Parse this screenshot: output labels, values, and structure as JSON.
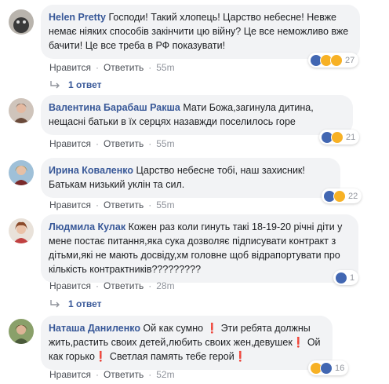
{
  "comments": [
    {
      "author": "Helen Pretty",
      "text": "Господи! Такий хлопець! Царство небесне! Невже немає ніяких способів закінчити цю війну? Це все неможливо вже бачити! Це все треба в РФ показувати!",
      "reactions": [
        "like",
        "sad",
        "wow"
      ],
      "reaction_count": "27",
      "like_label": "Нравится",
      "reply_label": "Ответить",
      "time": "55m",
      "replies_label": "1 ответ"
    },
    {
      "author": "Валентина Барабаш Ракша",
      "text": "Мати Божа,загинула дитина, нещасні батьки в їх серцях назавжди поселилось горе",
      "reactions": [
        "like",
        "sad"
      ],
      "reaction_count": "21",
      "like_label": "Нравится",
      "reply_label": "Ответить",
      "time": "55m"
    },
    {
      "author": "Ирина Коваленко",
      "text": "Царство небесне тобі, наш захисник! Батькам низький уклін та сил.",
      "reactions": [
        "like",
        "sad"
      ],
      "reaction_count": "22",
      "like_label": "Нравится",
      "reply_label": "Ответить",
      "time": "55m"
    },
    {
      "author": "Людмила Кулак",
      "text": "Кожен раз коли гинуть такі 18-19-20 річні діти у мене постає питання,яка сука дозволяє підписувати контракт з дітьми,які не мають досвіду,хм головне щоб відрапортувати про кількість контрактників?????????",
      "reactions": [
        "like"
      ],
      "reaction_count": "1",
      "like_label": "Нравится",
      "reply_label": "Ответить",
      "time": "28m",
      "replies_label": "1 ответ"
    },
    {
      "author": "Наташа Даниленко",
      "text": "Ой как сумно ❗ Эти ребята должны жить,растить своих детей,любить своих жен,девушек❗ Ой как горько❗ Светлая память тебе герой❗",
      "reactions": [
        "sad",
        "like"
      ],
      "reaction_count": "16",
      "like_label": "Нравится",
      "reply_label": "Ответить",
      "time": "52m"
    }
  ],
  "colors": {
    "author": "#385898",
    "bubble": "#f2f3f5",
    "meta": "#90949c",
    "like": "#4267b2",
    "sad": "#f7b125"
  }
}
